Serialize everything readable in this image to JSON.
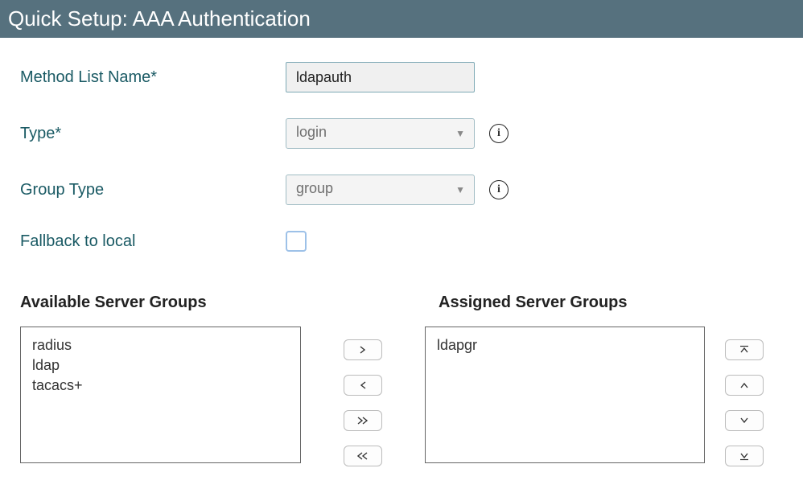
{
  "header": {
    "title": "Quick Setup: AAA Authentication"
  },
  "form": {
    "method_list_name": {
      "label": "Method List Name*",
      "value": "ldapauth"
    },
    "type": {
      "label": "Type*",
      "value": "login"
    },
    "group_type": {
      "label": "Group Type",
      "value": "group"
    },
    "fallback": {
      "label": "Fallback to local",
      "checked": false
    }
  },
  "groups": {
    "available_header": "Available Server Groups",
    "assigned_header": "Assigned Server Groups",
    "available": [
      "radius",
      "ldap",
      "tacacs+"
    ],
    "assigned": [
      "ldapgr"
    ]
  }
}
